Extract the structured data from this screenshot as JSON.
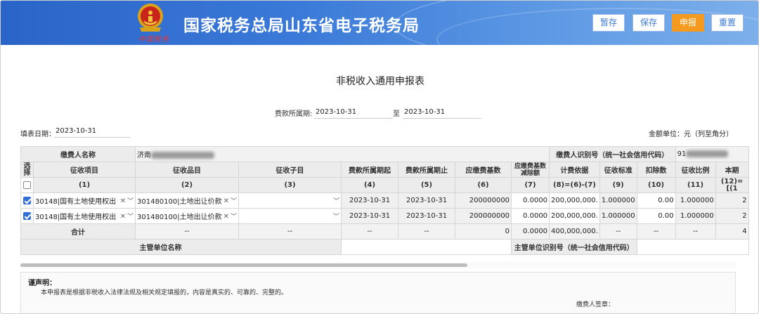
{
  "header": {
    "site_title": "国家税务总局山东省电子税务局",
    "slogan": "中国税务",
    "buttons": {
      "draft": "暂存",
      "save": "保存",
      "submit": "申报",
      "reset": "重置"
    }
  },
  "form": {
    "title": "非税收入通用申报表",
    "period_label": "费款所属期:",
    "period_from": "2023-10-31",
    "period_to_label": "至",
    "period_to": "2023-10-31",
    "fill_date_label": "填表日期：",
    "fill_date": "2023-10-31",
    "unit_label": "金额单位：元（列至角分）"
  },
  "table": {
    "payer_name_label": "缴费人名称",
    "payer_name_value": "济南",
    "payer_id_label": "缴费人识别号（统一社会信用代码）",
    "payer_id_value": "91",
    "headers": [
      "选择",
      "征收项目",
      "征收品目",
      "征收子目",
      "费款所属期起",
      "费款所属期止",
      "应缴费基数",
      "应缴费基数减除额",
      "计费依据",
      "征收标准",
      "扣除数",
      "征收比例",
      "本期"
    ],
    "header_nums": [
      "",
      "(1)",
      "(2)",
      "(3)",
      "(4)",
      "(5)",
      "(6)",
      "(7)",
      "(8)=(6)-(7)",
      "(9)",
      "(10)",
      "(11)",
      "(12)=[(1"
    ],
    "rows": [
      {
        "item": "30148|国有土地使用权出",
        "sub": "301480100|土地出让价款",
        "zimu": "",
        "from": "2023-10-31",
        "to": "2023-10-31",
        "base": "200000000",
        "deduct": "0.0000",
        "basis": "200,000,000.",
        "standard": "1.000000",
        "deduction": "0.00",
        "ratio": "1.000000",
        "current": "2"
      },
      {
        "item": "30148|国有土地使用权出",
        "sub": "301480100|土地出让价款",
        "zimu": "",
        "from": "2023-10-31",
        "to": "2023-10-31",
        "base": "200000000",
        "deduct": "0.0000",
        "basis": "200,000,000.",
        "standard": "1.000000",
        "deduction": "0.00",
        "ratio": "1.000000",
        "current": "2"
      }
    ],
    "total": {
      "label": "合计",
      "dash": "--",
      "base": "0",
      "deduct": "0.0000",
      "basis": "400,000,000.",
      "current": "4"
    },
    "supervisor_name_label": "主管单位名称",
    "supervisor_id_label": "主管单位识别号（统一社会信用代码）"
  },
  "declaration": {
    "title": "谨声明：",
    "body": "本申报表是根据非税收入法律法规及相关规定填报的，内容是真实的、可靠的、完整的。",
    "signature_label": "缴费人签章："
  }
}
